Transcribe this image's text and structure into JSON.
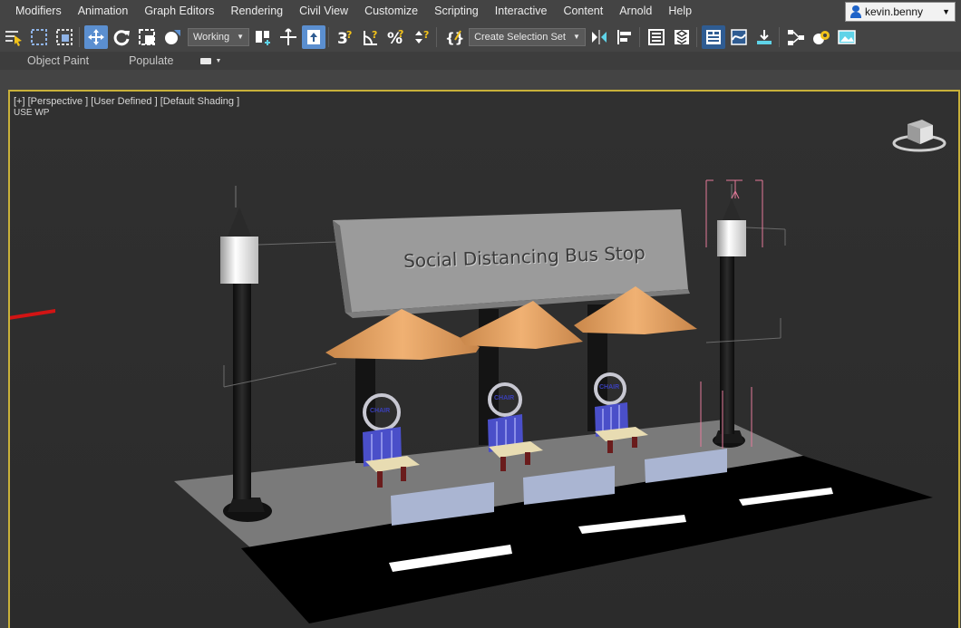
{
  "menu": [
    "Modifiers",
    "Animation",
    "Graph Editors",
    "Rendering",
    "Civil View",
    "Customize",
    "Scripting",
    "Interactive",
    "Content",
    "Arnold",
    "Help"
  ],
  "user": {
    "name": "kevin.benny"
  },
  "toolbar": {
    "selection_filter": "Working",
    "named_selection": "Create Selection Set",
    "buttons": [
      "select-by-name-icon",
      "rectangular-selection-icon",
      "window-crossing-icon",
      "select-and-move-icon",
      "select-and-rotate-icon",
      "select-and-scale-icon",
      "select-and-place-icon",
      "use-pivot-center-icon",
      "align-grid-icon",
      "select-and-manipulate-icon",
      "snaps-toggle-icon",
      "angle-snap-icon",
      "percent-snap-icon",
      "spinner-snap-icon",
      "edit-named-selection-icon",
      "mirror-icon",
      "align-icon",
      "layer-explorer-icon",
      "scene-explorer-icon",
      "toggle-ribbon-icon",
      "curve-editor-icon",
      "dope-sheet-icon",
      "schematic-view-icon",
      "material-editor-icon",
      "render-setup-icon"
    ],
    "accent": "#5b8fd0"
  },
  "ribbon": {
    "tabs": [
      "Object Paint",
      "Populate"
    ]
  },
  "viewport": {
    "label": "[+] [Perspective ] [User Defined ] [Default Shading ]",
    "sublabel": "USE WP",
    "border_color": "#c9b13a",
    "scene": {
      "billboard_text": "Social Distancing Bus Stop",
      "chair_text": "CHAIR"
    }
  }
}
